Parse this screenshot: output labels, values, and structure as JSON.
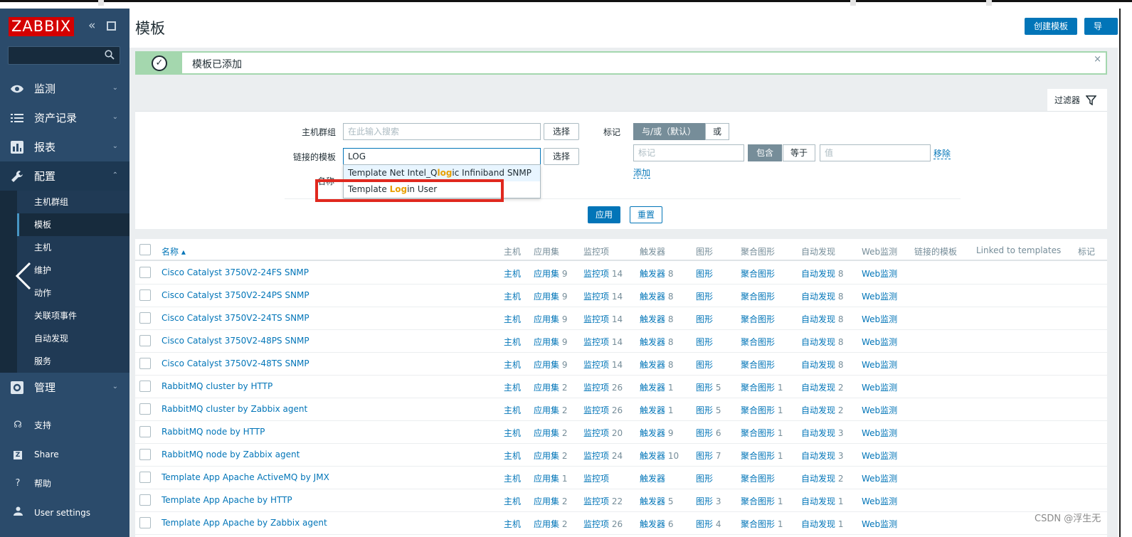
{
  "app": {
    "logo": "ZABBIX",
    "collapse_icon": "double-chevron-left",
    "kiosk_icon": "kiosk-mode"
  },
  "sidebar": {
    "search": {
      "value": "",
      "placeholder": ""
    },
    "menu": [
      {
        "label": "监测",
        "icon": "eye-icon",
        "chevron": "⌄"
      },
      {
        "label": "资产记录",
        "icon": "list-icon",
        "chevron": "⌄"
      },
      {
        "label": "报表",
        "icon": "bar-chart-icon",
        "chevron": "⌄"
      },
      {
        "label": "配置",
        "icon": "wrench-icon",
        "chevron": "⌃"
      }
    ],
    "submenu": [
      "主机群组",
      "模板",
      "主机",
      "维护",
      "动作",
      "关联项事件",
      "自动发现",
      "服务"
    ],
    "admin": {
      "label": "管理",
      "icon": "gear-icon",
      "chevron": "⌄"
    },
    "footer": [
      {
        "label": "支持",
        "icon": "headset-icon"
      },
      {
        "label": "Share",
        "icon": "share-icon"
      },
      {
        "label": "帮助",
        "icon": "question-icon"
      },
      {
        "label": "User settings",
        "icon": "user-icon"
      }
    ]
  },
  "header": {
    "title": "模板",
    "create_button": "创建模板",
    "import_button": "导入"
  },
  "message": {
    "text": "模板已添加",
    "close": "×"
  },
  "filter": {
    "tab_label": "过滤器",
    "host_group_label": "主机群组",
    "host_group_placeholder": "在此输入搜索",
    "select_button": "选择",
    "linked_template_label": "链接的模板",
    "linked_template_value": "LOG",
    "name_label": "名称",
    "tags_label": "标记",
    "tags_and_or": "与/或（默认）",
    "tags_or": "或",
    "tag_placeholder": "标记",
    "contains": "包含",
    "equals": "等于",
    "value_placeholder": "值",
    "remove": "移除",
    "add": "添加",
    "apply": "应用",
    "reset": "重置"
  },
  "autocomplete": [
    {
      "pre": "Template Net Intel_Q",
      "match": "log",
      "post": "ic Infiniband SNMP"
    },
    {
      "pre": "Template ",
      "match": "Log",
      "post": "in User"
    }
  ],
  "table": {
    "columns": [
      "名称 ▴",
      "主机",
      "应用集",
      "监控项",
      "触发器",
      "图形",
      "聚合图形",
      "自动发现",
      "Web监测",
      "链接的模板",
      "Linked to templates",
      "标记"
    ],
    "rows": [
      {
        "name": "Cisco Catalyst 3750V2-24FS SNMP",
        "hosts": "主机",
        "apps": "应用集",
        "apps_n": "9",
        "items": "监控项",
        "items_n": "14",
        "triggers": "触发器",
        "triggers_n": "8",
        "graphs": "图形",
        "graphs_n": "",
        "screens": "聚合图形",
        "screens_n": "",
        "discovery": "自动发现",
        "discovery_n": "8",
        "web": "Web监测"
      },
      {
        "name": "Cisco Catalyst 3750V2-24PS SNMP",
        "hosts": "主机",
        "apps": "应用集",
        "apps_n": "9",
        "items": "监控项",
        "items_n": "14",
        "triggers": "触发器",
        "triggers_n": "8",
        "graphs": "图形",
        "graphs_n": "",
        "screens": "聚合图形",
        "screens_n": "",
        "discovery": "自动发现",
        "discovery_n": "8",
        "web": "Web监测"
      },
      {
        "name": "Cisco Catalyst 3750V2-24TS SNMP",
        "hosts": "主机",
        "apps": "应用集",
        "apps_n": "9",
        "items": "监控项",
        "items_n": "14",
        "triggers": "触发器",
        "triggers_n": "8",
        "graphs": "图形",
        "graphs_n": "",
        "screens": "聚合图形",
        "screens_n": "",
        "discovery": "自动发现",
        "discovery_n": "8",
        "web": "Web监测"
      },
      {
        "name": "Cisco Catalyst 3750V2-48PS SNMP",
        "hosts": "主机",
        "apps": "应用集",
        "apps_n": "9",
        "items": "监控项",
        "items_n": "14",
        "triggers": "触发器",
        "triggers_n": "8",
        "graphs": "图形",
        "graphs_n": "",
        "screens": "聚合图形",
        "screens_n": "",
        "discovery": "自动发现",
        "discovery_n": "8",
        "web": "Web监测"
      },
      {
        "name": "Cisco Catalyst 3750V2-48TS SNMP",
        "hosts": "主机",
        "apps": "应用集",
        "apps_n": "9",
        "items": "监控项",
        "items_n": "14",
        "triggers": "触发器",
        "triggers_n": "8",
        "graphs": "图形",
        "graphs_n": "",
        "screens": "聚合图形",
        "screens_n": "",
        "discovery": "自动发现",
        "discovery_n": "8",
        "web": "Web监测"
      },
      {
        "name": "RabbitMQ cluster by HTTP",
        "hosts": "主机",
        "apps": "应用集",
        "apps_n": "2",
        "items": "监控项",
        "items_n": "26",
        "triggers": "触发器",
        "triggers_n": "1",
        "graphs": "图形",
        "graphs_n": "5",
        "screens": "聚合图形",
        "screens_n": "1",
        "discovery": "自动发现",
        "discovery_n": "2",
        "web": "Web监测"
      },
      {
        "name": "RabbitMQ cluster by Zabbix agent",
        "hosts": "主机",
        "apps": "应用集",
        "apps_n": "2",
        "items": "监控项",
        "items_n": "26",
        "triggers": "触发器",
        "triggers_n": "1",
        "graphs": "图形",
        "graphs_n": "5",
        "screens": "聚合图形",
        "screens_n": "1",
        "discovery": "自动发现",
        "discovery_n": "2",
        "web": "Web监测"
      },
      {
        "name": "RabbitMQ node by HTTP",
        "hosts": "主机",
        "apps": "应用集",
        "apps_n": "2",
        "items": "监控项",
        "items_n": "20",
        "triggers": "触发器",
        "triggers_n": "9",
        "graphs": "图形",
        "graphs_n": "6",
        "screens": "聚合图形",
        "screens_n": "1",
        "discovery": "自动发现",
        "discovery_n": "3",
        "web": "Web监测"
      },
      {
        "name": "RabbitMQ node by Zabbix agent",
        "hosts": "主机",
        "apps": "应用集",
        "apps_n": "2",
        "items": "监控项",
        "items_n": "24",
        "triggers": "触发器",
        "triggers_n": "10",
        "graphs": "图形",
        "graphs_n": "7",
        "screens": "聚合图形",
        "screens_n": "1",
        "discovery": "自动发现",
        "discovery_n": "3",
        "web": "Web监测"
      },
      {
        "name": "Template App Apache ActiveMQ by JMX",
        "hosts": "主机",
        "apps": "应用集",
        "apps_n": "1",
        "items": "监控项",
        "items_n": "",
        "triggers": "触发器",
        "triggers_n": "",
        "graphs": "图形",
        "graphs_n": "",
        "screens": "聚合图形",
        "screens_n": "",
        "discovery": "自动发现",
        "discovery_n": "2",
        "web": "Web监测"
      },
      {
        "name": "Template App Apache by HTTP",
        "hosts": "主机",
        "apps": "应用集",
        "apps_n": "2",
        "items": "监控项",
        "items_n": "22",
        "triggers": "触发器",
        "triggers_n": "5",
        "graphs": "图形",
        "graphs_n": "3",
        "screens": "聚合图形",
        "screens_n": "1",
        "discovery": "自动发现",
        "discovery_n": "1",
        "web": "Web监测"
      },
      {
        "name": "Template App Apache by Zabbix agent",
        "hosts": "主机",
        "apps": "应用集",
        "apps_n": "2",
        "items": "监控项",
        "items_n": "26",
        "triggers": "触发器",
        "triggers_n": "6",
        "graphs": "图形",
        "graphs_n": "4",
        "screens": "聚合图形",
        "screens_n": "1",
        "discovery": "自动发现",
        "discovery_n": "1",
        "web": "Web监测"
      }
    ]
  },
  "watermark": "CSDN @浮生无",
  "colors": {
    "sidebar": "#2b4b6b",
    "brand_red": "#d40000",
    "link_blue": "#0275b8",
    "success_green": "#a4d7ae",
    "highlight_box": "#e0281e",
    "match_orange": "#e8a000"
  }
}
